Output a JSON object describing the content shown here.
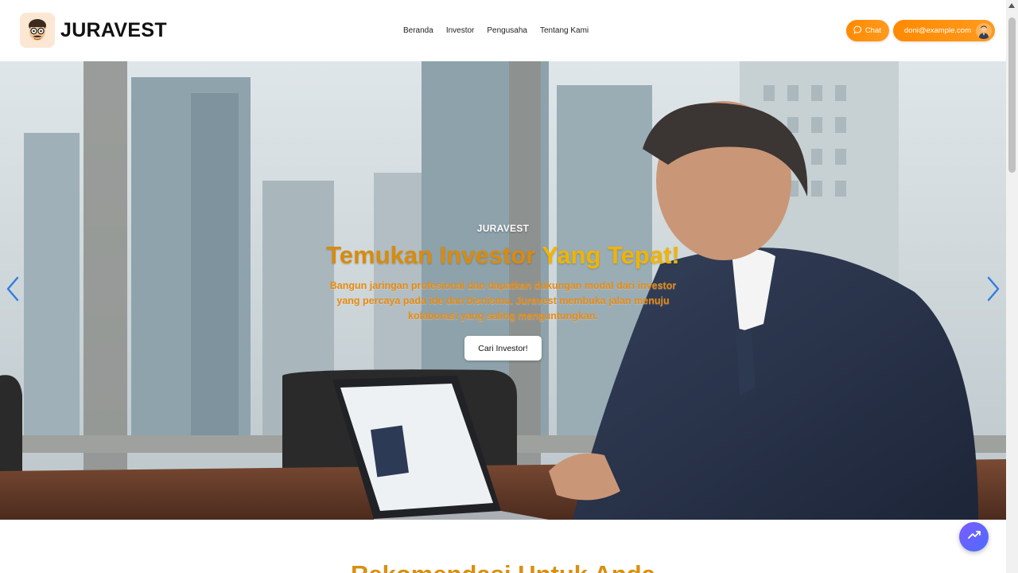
{
  "header": {
    "brand": "JURAVEST",
    "logo_icon": "mascot-face-icon",
    "nav": [
      {
        "label": "Beranda"
      },
      {
        "label": "Investor"
      },
      {
        "label": "Pengusaha"
      },
      {
        "label": "Tentang Kami"
      }
    ],
    "chat_label": "Chat",
    "chat_icon": "chat-bubble-icon",
    "user_email": "doni@example.com",
    "accent_color": "#ff8a00"
  },
  "hero": {
    "eyebrow": "JURAVEST",
    "headline_part1": "Temukan Investor",
    "headline_part2": "Yang Tepat!",
    "subtext": "Bangun jaringan profesional dan dapatkan dukungan modal dari investor yang percaya pada ide dan bisnismu. Juravest membuka jalan menuju kolaborasi yang saling menguntungkan.",
    "cta_label": "Cari Investor!",
    "prev_icon": "chevron-left-icon",
    "next_icon": "chevron-right-icon",
    "headline_color": "#e6a000"
  },
  "section": {
    "title": "Rekomendasi Untuk Anda"
  },
  "fab": {
    "icon": "trending-up-icon"
  }
}
